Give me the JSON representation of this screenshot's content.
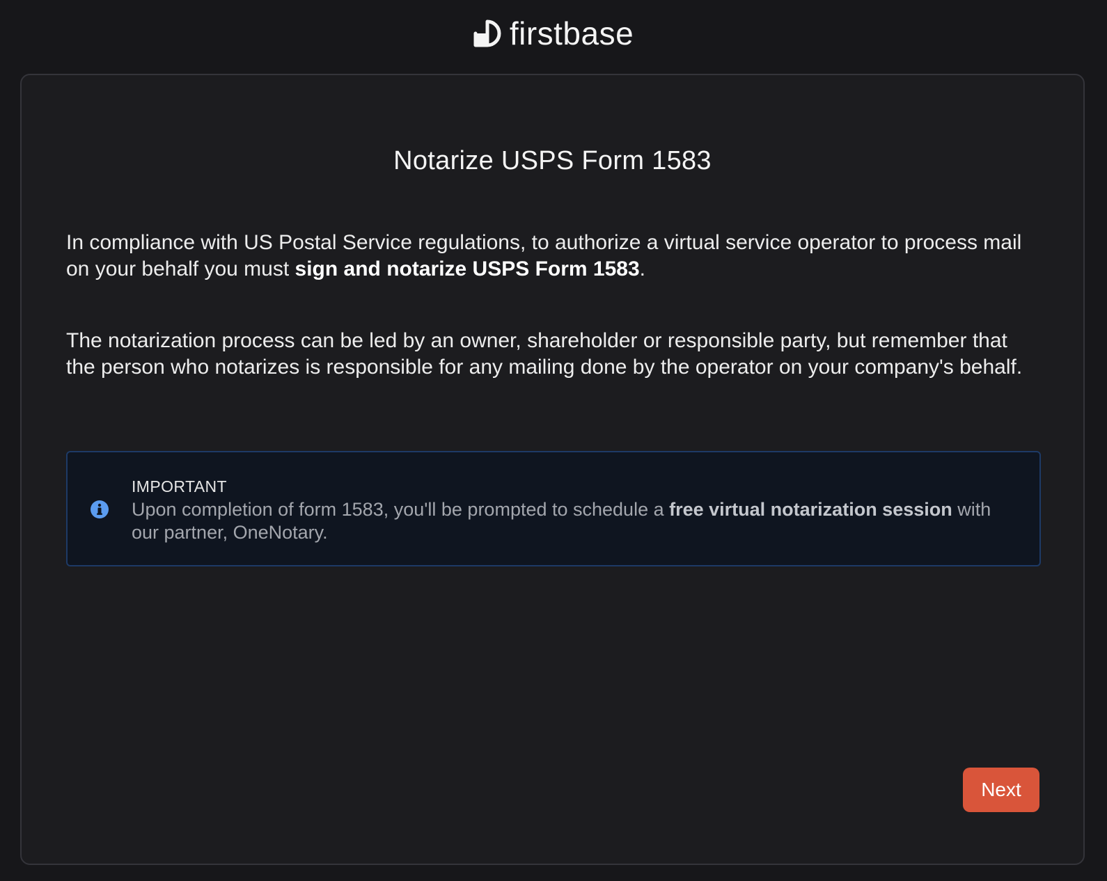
{
  "brand": {
    "name": "firstbase"
  },
  "page": {
    "title": "Notarize USPS Form 1583",
    "paragraph_1": {
      "text_before": "In compliance with US Postal Service regulations, to authorize a virtual service operator to process mail on your behalf you must ",
      "text_bold": "sign and notarize USPS Form 1583",
      "text_after": "."
    },
    "paragraph_2": "The notarization process can be led by an owner, shareholder or responsible party, but remember that the person who notarizes is responsible for any mailing done by the operator on your company's behalf."
  },
  "notice": {
    "icon": "info-icon",
    "heading": "IMPORTANT",
    "text_before": "Upon completion of form 1583, you'll be prompted to schedule a ",
    "text_bold": "free virtual notarization session",
    "text_after": " with our partner, OneNotary."
  },
  "actions": {
    "next_label": "Next"
  },
  "colors": {
    "background": "#17171a",
    "card": "#1c1c1f",
    "notice_border": "#1d3a66",
    "info_icon": "#5b9cf0",
    "accent_button": "#d9553a"
  }
}
